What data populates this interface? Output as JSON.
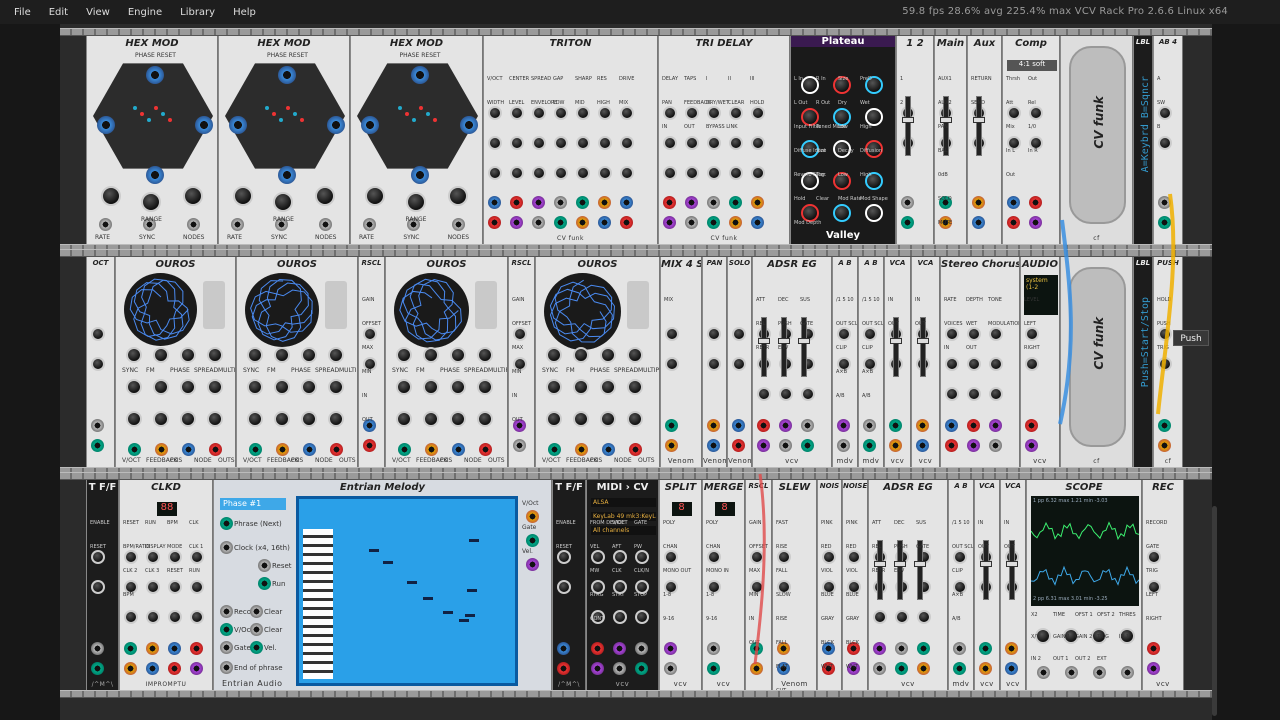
{
  "menu": [
    "File",
    "Edit",
    "View",
    "Engine",
    "Library",
    "Help"
  ],
  "status": "59.8 fps  28.6% avg  225.4% max    VCV Rack Pro 2.6.6 Linux x64",
  "tooltip": "Push",
  "colors": {
    "accent": "#3ea8e8",
    "screen_blue": "#2aa0e8",
    "panel": "#e4e4e4",
    "dark_panel": "#1c1c1c"
  },
  "row1": {
    "modules": [
      {
        "title": "HEX MOD",
        "sub": "PHASE RESET",
        "labels": [
          "RANGE",
          "RATE",
          "SYNC",
          "NODES"
        ],
        "brand": "CV funk"
      },
      {
        "title": "HEX MOD",
        "sub": "PHASE RESET",
        "labels": [
          "RANGE",
          "RATE",
          "SYNC",
          "NODES"
        ],
        "brand": "CV funk"
      },
      {
        "title": "HEX MOD",
        "sub": "PHASE RESET",
        "labels": [
          "RANGE",
          "RATE",
          "SYNC",
          "NODES"
        ],
        "brand": "CV funk"
      },
      {
        "title": "TRITON",
        "labels": [
          "V/OCT",
          "CENTER",
          "SPREAD",
          "GAP",
          "SHARP",
          "RES",
          "DRIVE",
          "WIDTH",
          "LEVEL",
          "ENVELOPE",
          "LOW",
          "MID",
          "HIGH",
          "MIX"
        ],
        "brand": "CV funk"
      },
      {
        "title": "TRI DELAY",
        "labels": [
          "DELAY",
          "TAPS",
          "I",
          "II",
          "III",
          "PAN",
          "FEEDBACK",
          "DRY/WET",
          "CLEAR",
          "HOLD",
          "IN",
          "OUT",
          "BYPASS LINK"
        ],
        "brand": "CV funk"
      },
      {
        "title": "Plateau",
        "sub": "Valley",
        "labels": [
          "L In",
          "R In",
          "Size",
          "PreD",
          "L Out",
          "R Out",
          "Dry",
          "Wet",
          "Input Filter",
          "Tuned Mode",
          "Low",
          "High",
          "Diffuse Input",
          "Size",
          "Decay",
          "Diffusion",
          "Reverb Filter",
          "Tog.",
          "Low",
          "High",
          "Hold",
          "Clear",
          "Mod Rate",
          "Mod Shape",
          "Mod Depth"
        ]
      },
      {
        "title": "1 2",
        "labels": [
          "1",
          "2"
        ]
      },
      {
        "title": "Main",
        "labels": [
          "AUX1",
          "AUX2",
          "PAN",
          "BAL",
          "0dB",
          "SOLO",
          "MUTE"
        ]
      },
      {
        "title": "Aux",
        "labels": [
          "RETURN",
          "SEND"
        ]
      },
      {
        "title": "Comp",
        "select": "4:1 soft",
        "labels": [
          "Thrsh",
          "Out",
          "Att",
          "Rel",
          "Mix",
          "1/0",
          "In L",
          "In R",
          "Out"
        ]
      },
      {
        "title": "CV funk",
        "brand": "cf"
      },
      {
        "title": "LBL",
        "text": "A=Keybrd  B=Sqncr"
      },
      {
        "title": "AB 4",
        "labels": [
          "A",
          "SW",
          "B"
        ]
      }
    ]
  },
  "row2": {
    "modules": [
      {
        "title": "OCT"
      },
      {
        "title": "OUROS",
        "labels": [
          "SYNC",
          "FM",
          "PHASE",
          "SPREAD",
          "MULTIPLY",
          "V/OCT",
          "FEEDBACK",
          "POS",
          "NODE",
          "OUTS"
        ],
        "brand": "CV funk"
      },
      {
        "title": "OUROS",
        "labels": [
          "SYNC",
          "FM",
          "PHASE",
          "SPREAD",
          "MULTIPLY",
          "V/OCT",
          "FEEDBACK",
          "POS",
          "NODE",
          "OUTS"
        ],
        "brand": "CV funk"
      },
      {
        "title": "RSCL",
        "labels": [
          "GAIN",
          "OFFSET",
          "MAX",
          "MIN",
          "IN",
          "OUT"
        ]
      },
      {
        "title": "OUROS",
        "labels": [
          "SYNC",
          "FM",
          "PHASE",
          "SPREAD",
          "MULTIPLY",
          "V/OCT",
          "FEEDBACK",
          "POS",
          "NODE",
          "OUTS"
        ],
        "brand": "CV funk"
      },
      {
        "title": "RSCL",
        "labels": [
          "GAIN",
          "OFFSET",
          "MAX",
          "MIN",
          "IN",
          "OUT"
        ]
      },
      {
        "title": "OUROS",
        "labels": [
          "SYNC",
          "FM",
          "PHASE",
          "SPREAD",
          "MULTIPLY",
          "V/OCT",
          "FEEDBACK",
          "POS",
          "NODE",
          "OUTS"
        ],
        "brand": "CV funk"
      },
      {
        "title": "MIX 4 ST",
        "labels": [
          "MIX"
        ],
        "brand": "Venom"
      },
      {
        "title": "PAN",
        "brand": "Venom"
      },
      {
        "title": "SOLO",
        "brand": "Venom"
      },
      {
        "title": "ADSR EG",
        "labels": [
          "ATT",
          "DEC",
          "SUS",
          "REL",
          "PUSH",
          "GATE",
          "RETR",
          "ENV"
        ],
        "brand": "vcv"
      },
      {
        "title": "A B",
        "labels": [
          "/1 5 10",
          "OUT SCL",
          "CLIP",
          "A×B",
          "A/B"
        ],
        "brand": "mdv"
      },
      {
        "title": "A B",
        "labels": [
          "/1 5 10",
          "OUT SCL",
          "CLIP",
          "A×B",
          "A/B"
        ],
        "brand": "mdv"
      },
      {
        "title": "VCA",
        "labels": [
          "IN",
          "OUT"
        ],
        "brand": "vcv"
      },
      {
        "title": "VCA",
        "labels": [
          "IN",
          "OUT"
        ],
        "brand": "vcv"
      },
      {
        "title": "Stereo Chorus",
        "labels": [
          "RATE",
          "DEPTH",
          "TONE",
          "VOICES",
          "WET",
          "MODULATION",
          "IN",
          "OUT"
        ]
      },
      {
        "title": "AUDIO",
        "screen": "system (1-2",
        "labels": [
          "LEVEL",
          "LEFT",
          "RIGHT"
        ],
        "brand": "vcv"
      },
      {
        "title": "CV funk",
        "brand": "cf"
      },
      {
        "title": "LBL",
        "text": "Push=Start/Stop"
      },
      {
        "title": "PUSH",
        "labels": [
          "HOLD",
          "PUSH",
          "TRIG"
        ],
        "brand": "cf"
      }
    ]
  },
  "row3": {
    "modules": [
      {
        "title": "T F/F",
        "labels": [
          "ENABLE",
          "RESET"
        ],
        "brand": "/^M^\\"
      },
      {
        "title": "CLKD",
        "labels": [
          "RESET",
          "RUN",
          "BPM",
          "CLK",
          "BPM/RATIO",
          "DISPLAY",
          "MODE",
          "CLK 1",
          "CLK 2",
          "CLK 3",
          "RESET",
          "RUN",
          "BPM"
        ],
        "display": "88",
        "brand": "IMPROMPTU"
      },
      {
        "title": "Entrian Melody",
        "phase": "Phase #1",
        "items": [
          "Phrase (Next)",
          "Clock (x4, 16th)",
          "Reset",
          "Run",
          "Record",
          "Clear",
          "V/Oct",
          "Clear",
          "Gate",
          "Vel.",
          "End of phrase"
        ],
        "outs": [
          "V/Oct",
          "Gate",
          "Vel."
        ],
        "brand": "Entrian Audio"
      },
      {
        "title": "T F/F",
        "labels": [
          "ENABLE",
          "RESET"
        ],
        "brand": "/^M^\\"
      },
      {
        "title": "MIDI › CV",
        "lines": [
          "ALSA",
          "KeyLab 49 mk3:KeyLa",
          "All channels"
        ],
        "labels": [
          "FROM DEVICE",
          "V/OCT",
          "GATE",
          "VEL",
          "AFT",
          "PW",
          "MW",
          "CLK",
          "CLK/N",
          "RTRG",
          "STRT",
          "STOP",
          "CONT"
        ],
        "brand": "vcv"
      },
      {
        "title": "SPLIT",
        "labels": [
          "POLY",
          "CHAN",
          "MONO OUT",
          "1-8",
          "9-16"
        ],
        "display": "8",
        "brand": "vcv"
      },
      {
        "title": "MERGE",
        "labels": [
          "POLY",
          "CHAN",
          "MONO IN",
          "1-8",
          "9-16"
        ],
        "display": "8",
        "brand": "vcv"
      },
      {
        "title": "RSCL",
        "labels": [
          "GAIN",
          "OFFSET",
          "MAX",
          "MIN",
          "IN",
          "OUT"
        ]
      },
      {
        "title": "SLEW",
        "labels": [
          "FAST",
          "RISE",
          "FALL",
          "SLOW",
          "RISE",
          "FALL",
          "FLAT",
          "CUT"
        ],
        "brand": "Venom"
      },
      {
        "title": "NOIS",
        "labels": [
          "PINK",
          "RED",
          "VIOL",
          "BLUE",
          "GRAY",
          "BLCK",
          "WHT"
        ]
      },
      {
        "title": "NOISE",
        "labels": [
          "PINK",
          "RED",
          "VIOL",
          "BLUE",
          "GRAY",
          "BLCK",
          "WHT"
        ]
      },
      {
        "title": "ADSR EG",
        "labels": [
          "ATT",
          "DEC",
          "SUS",
          "REL",
          "PUSH",
          "GATE",
          "RETR",
          "ENV"
        ],
        "brand": "vcv"
      },
      {
        "title": "A B",
        "labels": [
          "/1 5 10",
          "OUT SCL",
          "CLIP",
          "A×B",
          "A/B"
        ],
        "brand": "mdv"
      },
      {
        "title": "VCA",
        "labels": [
          "IN",
          "OUT"
        ],
        "brand": "vcv"
      },
      {
        "title": "VCA",
        "labels": [
          "IN",
          "OUT"
        ],
        "brand": "vcv"
      },
      {
        "title": "SCOPE",
        "lines": [
          "1  pp  6.32  max  1.21  min  -3.03",
          "2  pp  6.31  max  3.01  min  -3.25"
        ],
        "labels": [
          "X2",
          "TIME",
          "OFST 1",
          "OFST 2",
          "THRES",
          "X/Y",
          "GAIN 1",
          "GAIN 2",
          "TRIG",
          "IN 1",
          "IN 2",
          "OUT 1",
          "OUT 2",
          "EXT"
        ],
        "brand": "vcv"
      },
      {
        "title": "REC",
        "labels": [
          "RECORD",
          "GATE",
          "TRIG",
          "LEFT",
          "RIGHT"
        ],
        "brand": "vcv"
      }
    ]
  }
}
